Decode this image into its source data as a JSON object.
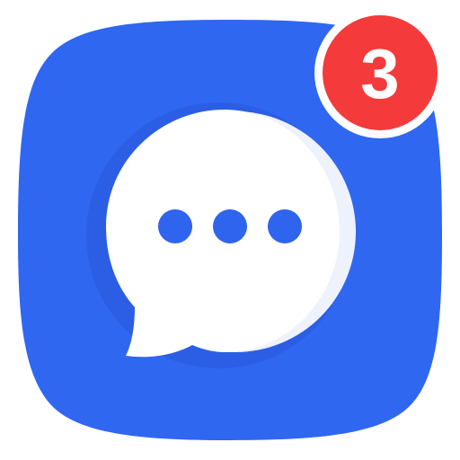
{
  "app": {
    "icon": "chat-bubble-icon",
    "notification_count": "3"
  },
  "colors": {
    "squircle_blue": "#2F67F1",
    "squircle_shadow": "#2858D8",
    "bubble_white": "#FFFFFF",
    "bubble_shade": "#EEF2FC",
    "dots_blue": "#2E64EE",
    "badge_red": "#F43A3A",
    "badge_ring": "#FFFFFF",
    "badge_text": "#FFFFFF"
  }
}
